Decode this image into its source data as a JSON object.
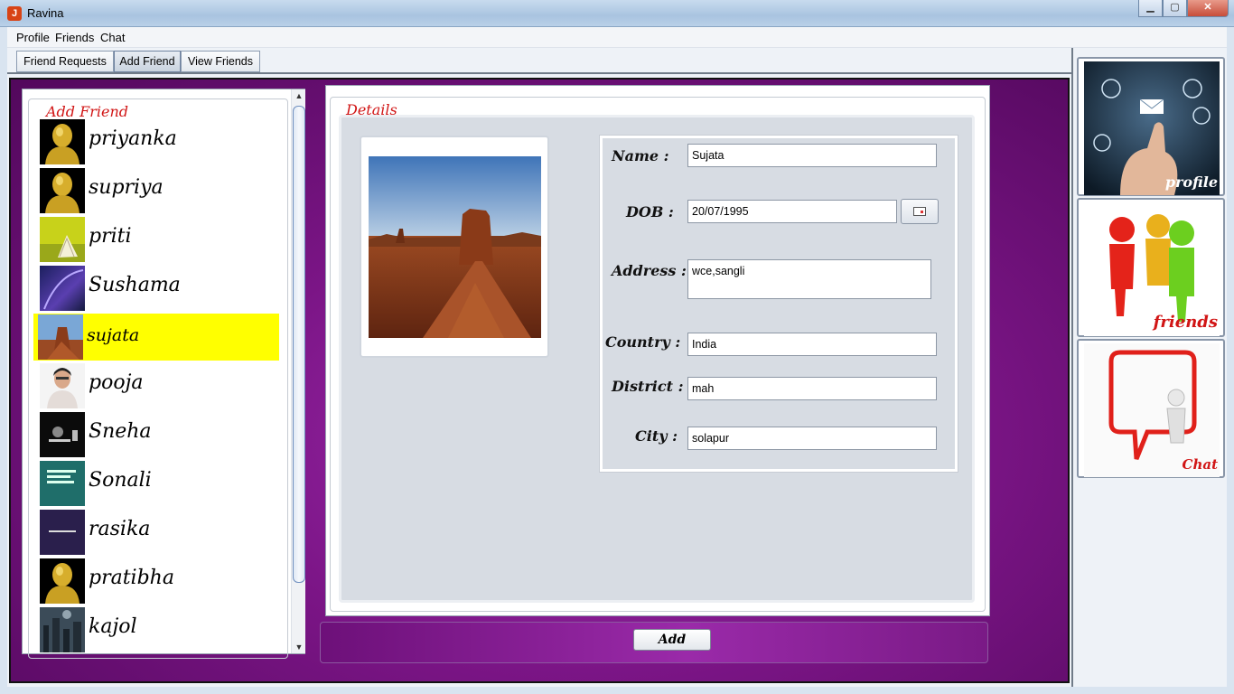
{
  "window": {
    "title": "Ravina",
    "buttons": [
      "minimize",
      "maximize",
      "close"
    ]
  },
  "menu": [
    "Profile",
    "Friends",
    "Chat"
  ],
  "tabs": [
    {
      "label": "Friend Requests",
      "active": false
    },
    {
      "label": "Add Friend",
      "active": true
    },
    {
      "label": "View Friends",
      "active": false
    }
  ],
  "add_friend": {
    "title": "Add Friend",
    "friends": [
      {
        "name": "priyanka",
        "avatar": "default-person-icon",
        "selected": false
      },
      {
        "name": "supriya",
        "avatar": "default-person-icon",
        "selected": false
      },
      {
        "name": "priti",
        "avatar": "book-photo",
        "selected": false
      },
      {
        "name": "Sushama",
        "avatar": "purple-abstract-photo",
        "selected": false
      },
      {
        "name": "sujata",
        "avatar": "desert-photo",
        "selected": true
      },
      {
        "name": "pooja",
        "avatar": "portrait-photo",
        "selected": false
      },
      {
        "name": "Sneha",
        "avatar": "dark-text-photo",
        "selected": false
      },
      {
        "name": "Sonali",
        "avatar": "teal-text-photo",
        "selected": false
      },
      {
        "name": "rasika",
        "avatar": "purple-text-photo",
        "selected": false
      },
      {
        "name": "pratibha",
        "avatar": "default-person-icon",
        "selected": false
      },
      {
        "name": "kajol",
        "avatar": "city-photo",
        "selected": false
      }
    ],
    "selection_color": "#ffff00"
  },
  "details": {
    "title": "Details",
    "name_label": "Name :",
    "name_value": "Sujata",
    "dob_label": "DOB :",
    "dob_value": "20/07/1995",
    "address_label": "Address :",
    "address_value": "wce,sangli",
    "country_label": "Country :",
    "country_value": "India",
    "district_label": "District :",
    "district_value": "mah",
    "city_label": "City :",
    "city_value": "solapur"
  },
  "actions": {
    "add_label": "Add"
  },
  "nav": {
    "profile_label": "profile",
    "friends_label": "friends",
    "chat_label": "Chat"
  },
  "colors": {
    "accent_red": "#d11515",
    "purple_bg": "#7b1586"
  }
}
